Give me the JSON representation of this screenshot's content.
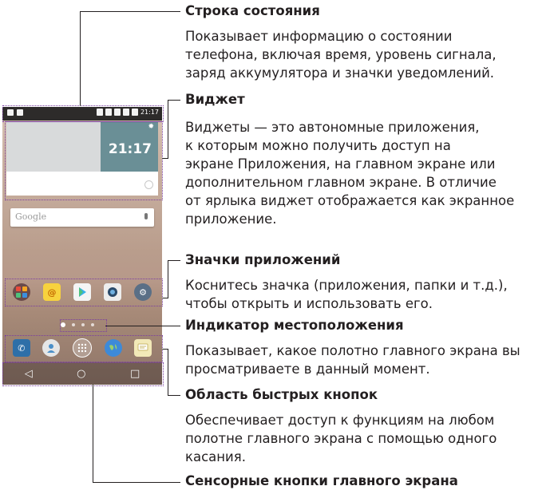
{
  "phone": {
    "status_time": "21:17",
    "widget_time": "21:17",
    "search_logo": "Google",
    "nav": {
      "back": "◁",
      "home": "○",
      "recent": "□"
    }
  },
  "annotations": [
    {
      "title": "Строка состояния",
      "lines": [
        "Показывает информацию о состоянии",
        "телефона, включая время, уровень сигнала,",
        "заряд аккумулятора и значки уведомлений."
      ]
    },
    {
      "title": "Виджет",
      "lines": [
        "Виджеты — это автономные приложения,",
        "к которым можно получить доступ на",
        "экране Приложения, на главном экране или",
        "дополнительном главном экране. В отличие",
        "от ярлыка виджет отображается как экранное",
        "приложение."
      ]
    },
    {
      "title": "Значки приложений",
      "lines": [
        "Коснитесь значка (приложения, папки и т.д.),",
        "чтобы открыть и использовать его."
      ]
    },
    {
      "title": "Индикатор местоположения",
      "lines": [
        "Показывает, какое полотно главного экрана вы",
        "просматриваете в данный момент."
      ]
    },
    {
      "title": "Область быстрых кнопок",
      "lines": [
        "Обеспечивает доступ к функциям на любом",
        "полотне главного экрана с помощью одного",
        "касания."
      ]
    },
    {
      "title": "Сенсорные кнопки главного экрана",
      "lines": []
    }
  ],
  "colors": {
    "callout_border": "#7a3ea0",
    "widget_clock_bg": "#6a8f96",
    "statusbar_bg": "#2d2b2a"
  },
  "icons": {
    "apps": [
      "folder-icon",
      "email-icon",
      "play-store-icon",
      "camera-icon",
      "settings-icon"
    ],
    "dock": [
      "phone-icon",
      "contacts-icon",
      "apps-drawer-icon",
      "browser-icon",
      "messaging-icon"
    ]
  }
}
